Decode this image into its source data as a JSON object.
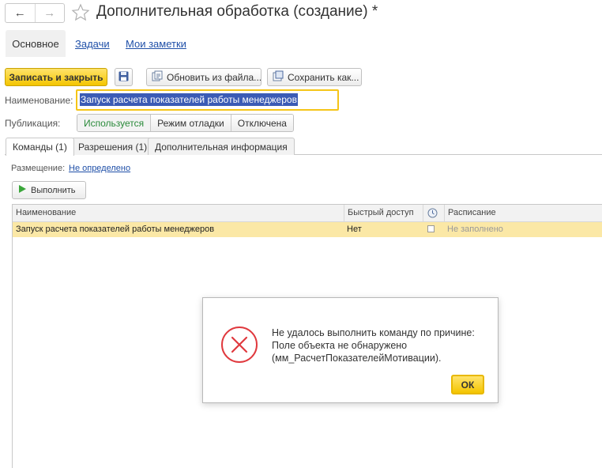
{
  "window": {
    "title": "Дополнительная обработка (создание) *",
    "back_icon": "←",
    "forward_icon": "→"
  },
  "sections": {
    "main": "Основное",
    "tasks": "Задачи",
    "notes": "Мои заметки"
  },
  "toolbar": {
    "save_close": "Записать и закрыть",
    "load_from_file": "Обновить из файла...",
    "save_as": "Сохранить как..."
  },
  "form": {
    "name_label": "Наименование:",
    "name_value": "Запуск расчета показателей работы менеджеров",
    "publication_label": "Публикация:",
    "publication_options": [
      "Используется",
      "Режим отладки",
      "Отключена"
    ],
    "publication_selected": "Используется"
  },
  "tabs": [
    {
      "label": "Команды (1)",
      "active": true
    },
    {
      "label": "Разрешения (1)",
      "active": false
    },
    {
      "label": "Дополнительная информация",
      "active": false
    }
  ],
  "commands": {
    "placement_label": "Размещение:",
    "placement_value": "Не определено",
    "run_label": "Выполнить",
    "columns": {
      "name": "Наименование",
      "quick_access": "Быстрый доступ",
      "schedule": "Расписание"
    },
    "rows": [
      {
        "name": "Запуск расчета показателей работы менеджеров",
        "quick_access": "Нет",
        "schedule": "Не заполнено"
      }
    ]
  },
  "dialog": {
    "lines": [
      "Не удалось выполнить команду по причине:",
      "Поле объекта не обнаружено",
      "(мм_РасчетПоказателейМотивации)."
    ],
    "ok_label": "ОК"
  },
  "colors": {
    "accent_yellow": "#f4c500",
    "link_blue": "#2050a8",
    "selected_row": "#fbe8a6",
    "error_red": "#e0393e",
    "used_green": "#2a8a3a"
  }
}
